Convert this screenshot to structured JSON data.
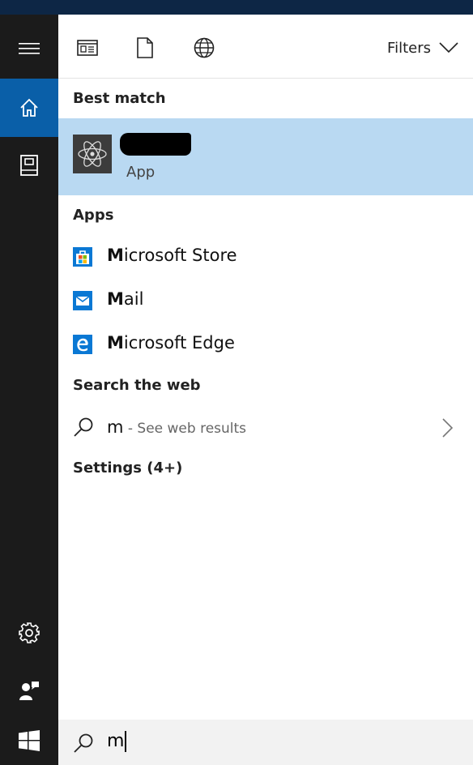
{
  "sidebar": {
    "menu_icon": "hamburger-icon",
    "items": [
      {
        "icon": "home-icon"
      },
      {
        "icon": "notebook-icon"
      },
      {
        "icon": "gear-icon"
      },
      {
        "icon": "feedback-icon"
      },
      {
        "icon": "windows-logo-icon"
      }
    ]
  },
  "toolbar": {
    "filters_label": "Filters"
  },
  "best_match": {
    "heading": "Best match",
    "app_type": "App"
  },
  "apps": {
    "heading": "Apps",
    "items": [
      {
        "name_bold": "M",
        "name_rest": "icrosoft Store",
        "icon": "store-icon"
      },
      {
        "name_bold": "M",
        "name_rest": "ail",
        "icon": "mail-icon"
      },
      {
        "name_bold": "M",
        "name_rest": "icrosoft Edge",
        "icon": "edge-icon"
      }
    ]
  },
  "web": {
    "heading": "Search the web",
    "query": "m",
    "suffix": " - See web results"
  },
  "settings": {
    "heading": "Settings (4+)"
  },
  "searchbox": {
    "value": "m"
  },
  "colors": {
    "sidebar": "#1b1b1b",
    "accent": "#0a5fa8",
    "selection": "#b9d9f2",
    "topstrip": "#0d2645"
  }
}
